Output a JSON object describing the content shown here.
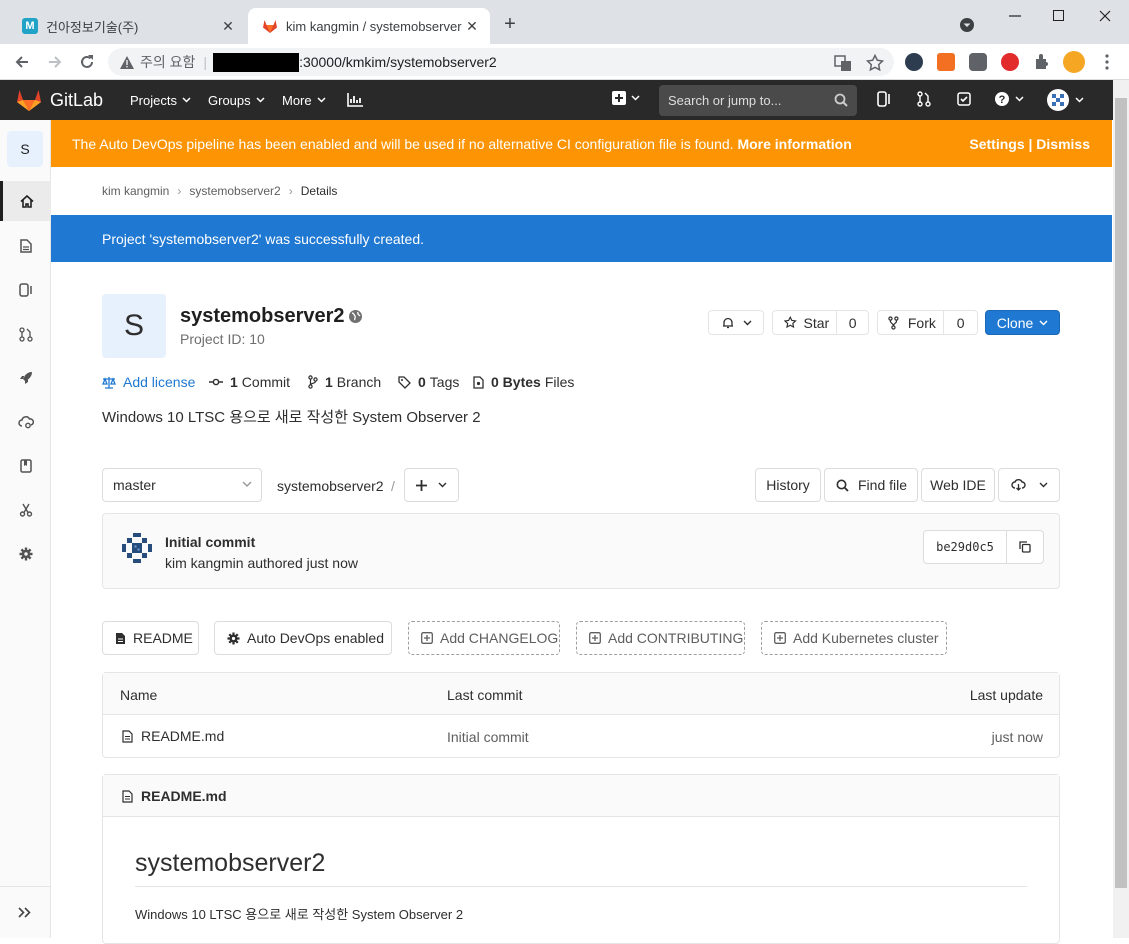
{
  "browser": {
    "tabs": [
      {
        "title": "건아정보기술(주)",
        "favicon_letter": "M"
      },
      {
        "title": "kim kangmin / systemobserver2"
      }
    ],
    "omnibox": {
      "security_label": "주의 요함",
      "url_visible": ":30000/kmkim/systemobserver2"
    }
  },
  "gitlab_header": {
    "brand": "GitLab",
    "nav": [
      "Projects",
      "Groups",
      "More"
    ],
    "search_placeholder": "Search or jump to..."
  },
  "sidebar": {
    "project_letter": "S",
    "items": [
      "project-overview",
      "repository",
      "issues",
      "merge-requests",
      "ci-cd",
      "operations",
      "wiki",
      "snippets",
      "settings"
    ]
  },
  "autodevops_banner": {
    "message": "The Auto DevOps pipeline has been enabled and will be used if no alternative CI configuration file is found.",
    "link": "More information",
    "actions": "Settings | Dismiss"
  },
  "breadcrumb": [
    "kim kangmin",
    "systemobserver2",
    "Details"
  ],
  "flash": "Project 'systemobserver2' was successfully created.",
  "project": {
    "avatar_letter": "S",
    "name": "systemobserver2",
    "id_label": "Project ID: 10",
    "star_label": "Star",
    "star_count": "0",
    "fork_label": "Fork",
    "fork_count": "0",
    "clone_label": "Clone",
    "stats": {
      "license": "Add license",
      "commits_n": "1",
      "commits_label": "Commit",
      "branches_n": "1",
      "branches_label": "Branch",
      "tags_n": "0",
      "tags_label": "Tags",
      "size_n": "0 Bytes",
      "size_label": "Files"
    },
    "description": "Windows 10 LTSC 용으로 새로 작성한 System Observer 2"
  },
  "tree": {
    "branch": "master",
    "path": "systemobserver2",
    "path_sep": "/",
    "history": "History",
    "find_file": "Find file",
    "web_ide": "Web IDE"
  },
  "last_commit": {
    "title": "Initial commit",
    "author_line": "kim kangmin authored just now",
    "sha": "be29d0c5"
  },
  "quick_buttons": [
    "README",
    "Auto DevOps enabled",
    "Add CHANGELOG",
    "Add CONTRIBUTING",
    "Add Kubernetes cluster"
  ],
  "files": {
    "headers": [
      "Name",
      "Last commit",
      "Last update"
    ],
    "rows": [
      {
        "name": "README.md",
        "commit": "Initial commit",
        "updated": "just now"
      }
    ]
  },
  "readme": {
    "filename": "README.md",
    "heading": "systemobserver2",
    "body": "Windows 10 LTSC 용으로 새로 작성한 System Observer 2"
  },
  "colors": {
    "gitlab_header": "#292929",
    "autodevops_banner": "#fc9403",
    "flash": "#1f78d1",
    "clone_button": "#1f78d1"
  }
}
